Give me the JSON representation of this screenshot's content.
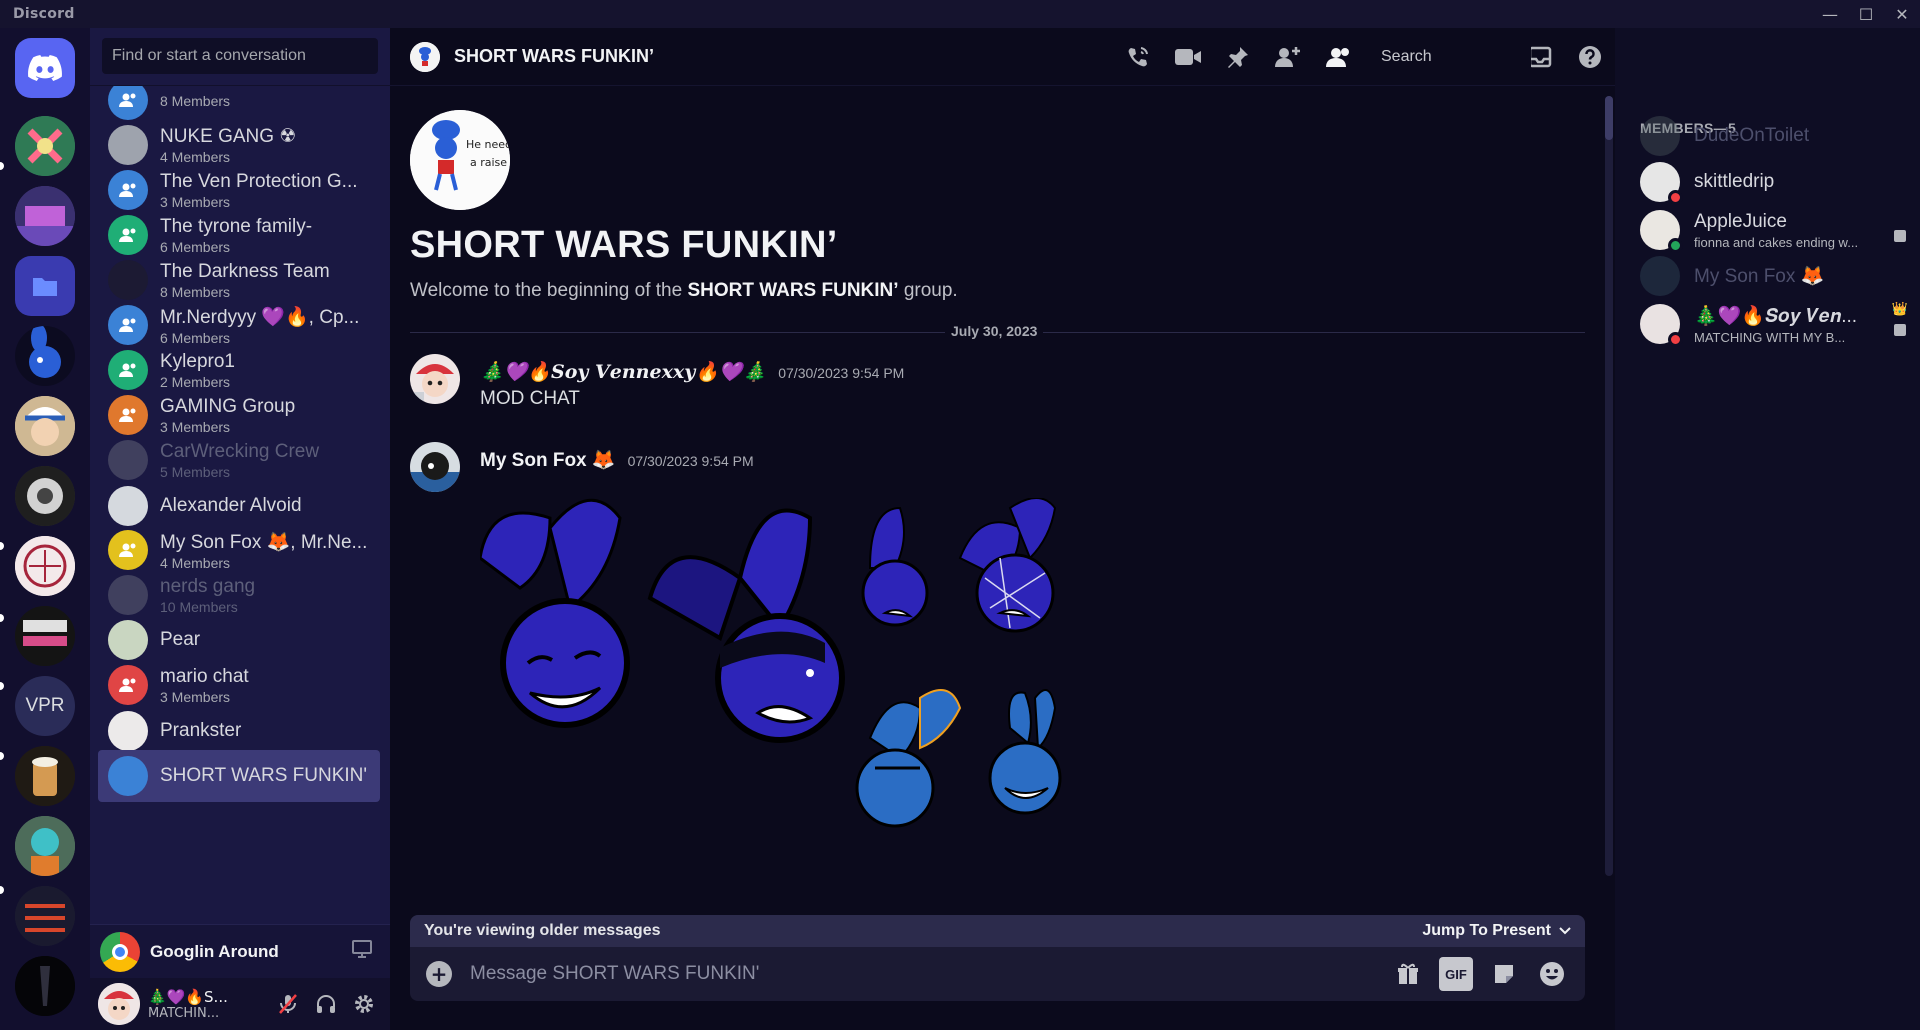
{
  "app": {
    "title": "Discord"
  },
  "window_controls": {
    "minimize": "—",
    "maximize": "☐",
    "close": "✕"
  },
  "rail": {
    "items": [
      {
        "name": "home",
        "kind": "home"
      },
      {
        "name": "server-1"
      },
      {
        "name": "server-2"
      },
      {
        "name": "folder"
      },
      {
        "name": "server-4"
      },
      {
        "name": "server-5"
      },
      {
        "name": "server-6"
      },
      {
        "name": "server-7"
      },
      {
        "name": "server-8"
      },
      {
        "name": "server-vpr",
        "text": "VPR"
      },
      {
        "name": "server-10"
      },
      {
        "name": "server-11"
      },
      {
        "name": "server-12"
      },
      {
        "name": "server-13"
      }
    ]
  },
  "dm": {
    "search_placeholder": "Find or start a conversation",
    "items": [
      {
        "name": "",
        "sub": "8 Members",
        "color": "#3b82d6",
        "group": true
      },
      {
        "name": "NUKE GANG ☢",
        "sub": "4 Members",
        "color": "#9ea3ad"
      },
      {
        "name": "The Ven Protection G...",
        "sub": "3 Members",
        "color": "#3b82d6",
        "group": true
      },
      {
        "name": "The tyrone family-",
        "sub": "6 Members",
        "color": "#1fae76",
        "group": true
      },
      {
        "name": "The Darkness Team",
        "sub": "8 Members",
        "color": "#1c1a33"
      },
      {
        "name": "Mr.Nerdyyy 💜🔥, Cp...",
        "sub": "6 Members",
        "color": "#3b82d6",
        "group": true
      },
      {
        "name": "Kylepro1",
        "sub": "2 Members",
        "color": "#1fae76",
        "group": true
      },
      {
        "name": "GAMING Group",
        "sub": "3 Members",
        "color": "#e0782d",
        "group": true
      },
      {
        "name": "CarWrecking Crew",
        "sub": "5 Members",
        "color": "#6f7180",
        "muted": true
      },
      {
        "name": "Alexander Alvoid",
        "sub": "",
        "color": "#d5d9de"
      },
      {
        "name": "My Son Fox 🦊, Mr.Ne...",
        "sub": "4 Members",
        "color": "#e3c11d",
        "group": true
      },
      {
        "name": "nerds gang",
        "sub": "10 Members",
        "color": "#6f7180",
        "muted": true
      },
      {
        "name": "Pear",
        "sub": "",
        "color": "#c9d6c1"
      },
      {
        "name": "mario chat",
        "sub": "3 Members",
        "color": "#e04545",
        "group": true
      },
      {
        "name": "Prankster",
        "sub": "",
        "color": "#eceaea"
      },
      {
        "name": "SHORT WARS FUNKIN'",
        "sub": "",
        "color": "#3b82d6",
        "selected": true
      }
    ]
  },
  "activity": {
    "label": "Googlin Around"
  },
  "user": {
    "name": "🎄💜🔥S...",
    "status": "MATCHIN..."
  },
  "channel": {
    "title": "SHORT WARS FUNKIN’",
    "search_placeholder": "Search"
  },
  "welcome": {
    "title": "SHORT WARS FUNKIN’",
    "sub_prefix": "Welcome to the beginning of the ",
    "sub_group": "SHORT WARS FUNKIN’",
    "sub_suffix": " group."
  },
  "divider": {
    "date": "July 30, 2023"
  },
  "messages": [
    {
      "author": "🎄💜🔥𝑺𝒐𝒚 𝑽𝒆𝒏𝒏𝒆𝒙𝒙𝒚🔥💜🎄",
      "time": "07/30/2023 9:54 PM",
      "body": "MOD CHAT"
    },
    {
      "author": "My Son Fox 🦊",
      "time": "07/30/2023 9:54 PM",
      "body": ""
    }
  ],
  "older_bar": {
    "left": "You're viewing older messages",
    "right": "Jump To Present"
  },
  "composer": {
    "placeholder": "Message SHORT WARS FUNKIN'",
    "gif": "GIF"
  },
  "members": {
    "header": "MEMBERS—5",
    "items": [
      {
        "name": "DudeOnToilet",
        "activity": "",
        "offline": true,
        "color": "#566"
      },
      {
        "name": "skittledrip",
        "activity": "",
        "status": "#f23f43",
        "color": "#e6e6e6"
      },
      {
        "name": "AppleJuice",
        "activity": "fionna and cakes ending w...",
        "status": "#23a55a",
        "color": "#eae7e2"
      },
      {
        "name": "My Son Fox 🦊",
        "activity": "",
        "offline": true,
        "color": "#3a5a66"
      },
      {
        "name": "🎄💜🔥𝑺𝒐𝒚 𝑽𝒆𝒏...",
        "activity": "MATCHING WITH MY B...",
        "status": "#f23f43",
        "color": "#e9e2e2",
        "crown": true
      }
    ]
  },
  "colors": {
    "accent": "#5865f2",
    "online": "#23a55a",
    "dnd": "#f23f43",
    "bunny_blue": "#2d24b8"
  }
}
